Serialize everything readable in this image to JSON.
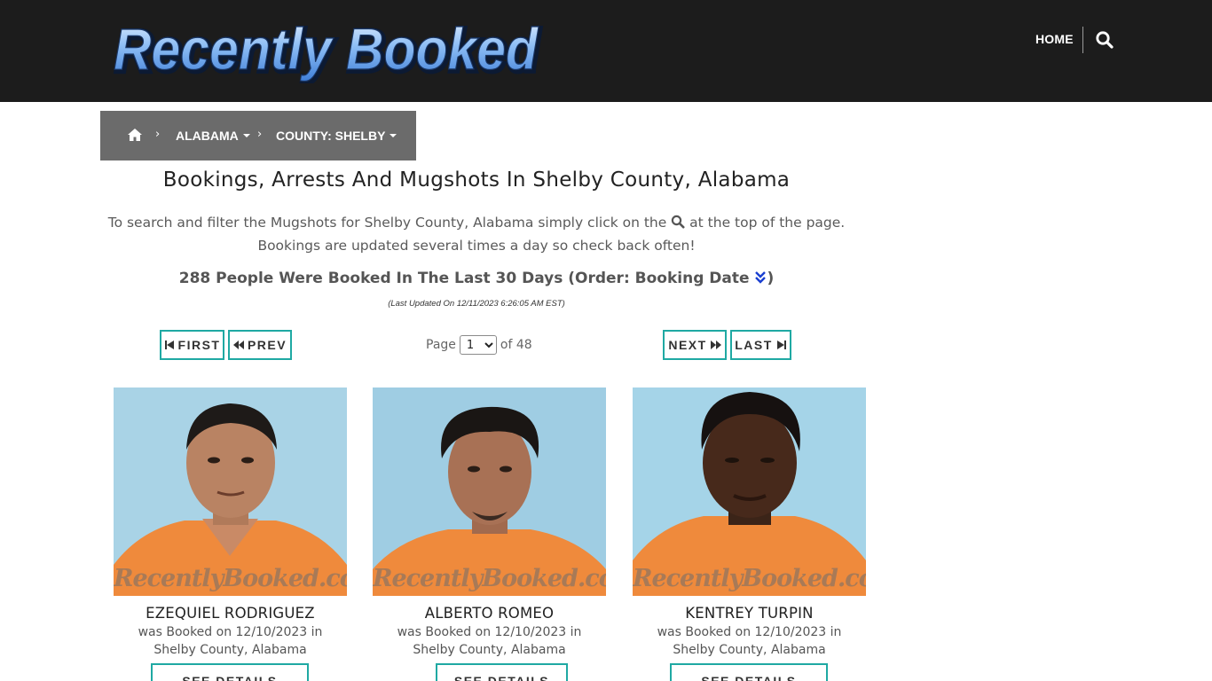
{
  "site": {
    "logo_text": "Recently Booked",
    "nav": {
      "home_label": "HOME"
    }
  },
  "breadcrumb": {
    "state": "ALABAMA",
    "county": "COUNTY: SHELBY"
  },
  "page": {
    "title": "Bookings, Arrests And Mugshots In Shelby County, Alabama",
    "intro_before": "To search and filter the Mugshots for Shelby County, Alabama simply click on the",
    "intro_after": "at the top of the page.",
    "intro_line2": "Bookings are updated several times a day so check back often!",
    "count_text": "288 People Were Booked In The Last 30 Days (Order: Booking Date",
    "count_close": ")",
    "last_updated": "(Last Updated On 12/11/2023 6:26:05 AM EST)"
  },
  "pager": {
    "first_label": "FIRST",
    "prev_label": "PREV",
    "next_label": "NEXT",
    "last_label": "LAST",
    "page_prefix": "Page",
    "current_page": "1",
    "page_suffix": "of 48"
  },
  "watermark": "RecentlyBooked.com",
  "bookings": [
    {
      "name": "EZEQUIEL RODRIGUEZ",
      "line1": "was Booked on 12/10/2023 in",
      "line2": "Shelby County, Alabama",
      "details_label": "SEE DETAILS"
    },
    {
      "name": "ALBERTO ROMEO",
      "line1": "was Booked on 12/10/2023 in",
      "line2": "Shelby County, Alabama",
      "details_label": "SEE DETAILS"
    },
    {
      "name": "KENTREY TURPIN",
      "line1": "was Booked on 12/10/2023 in",
      "line2": "Shelby County, Alabama",
      "details_label": "SEE DETAILS"
    }
  ],
  "colors": {
    "header_bg": "#1c1c1c",
    "breadcrumb_bg": "#6b6b6b",
    "button_border": "#1fa9a3",
    "photo_bg": "#a9d3e6",
    "jumpsuit": "#ef8a3c",
    "sort_icon": "#1a3fd1"
  },
  "icons": {
    "search": "search-icon",
    "home": "home-icon",
    "sort": "double-chevron-down-icon",
    "first": "step-backward-icon",
    "prev": "fast-backward-icon",
    "next": "fast-forward-icon",
    "last": "step-forward-icon"
  }
}
